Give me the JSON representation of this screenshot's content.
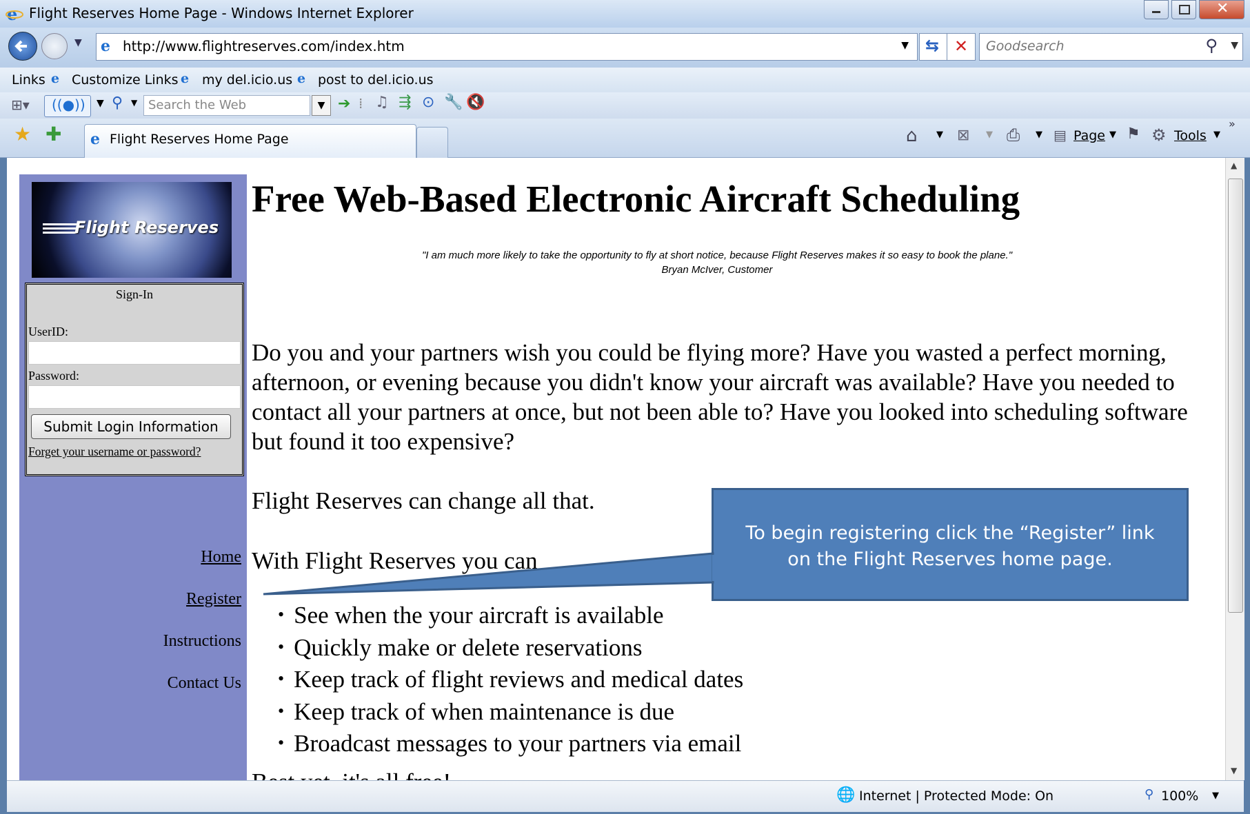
{
  "window": {
    "title": "Flight Reserves Home Page - Windows Internet Explorer"
  },
  "address_bar": {
    "url": "http://www.flightreserves.com/index.htm",
    "search_placeholder": "Goodsearch"
  },
  "links_bar": {
    "label": "Links",
    "items": [
      "Customize Links",
      "my del.icio.us",
      "post to del.icio.us"
    ]
  },
  "toolbar2": {
    "search_placeholder": "Search the Web"
  },
  "tab_bar": {
    "active_tab": "Flight Reserves Home Page",
    "page_menu": "Page",
    "tools_menu": "Tools"
  },
  "page": {
    "logo_text": "Flight Reserves",
    "signin": {
      "title": "Sign-In",
      "userid_label": "UserID:",
      "password_label": "Password:",
      "submit_label": "Submit Login Information",
      "forgot_link": "Forget your username or password?"
    },
    "nav": [
      "Home",
      "Register",
      "Instructions",
      "Contact Us"
    ],
    "headline": "Free Web-Based Electronic Aircraft Scheduling",
    "quote": "\"I am much more likely to take the opportunity to fly at short notice, because Flight Reserves makes it so easy to book the plane.\"",
    "quote_author": "Bryan McIver, Customer",
    "intro": "Do you and your partners wish you could be flying more? Have you wasted a perfect morning, afternoon, or evening because you didn't know your aircraft was available? Have you needed to contact all your partners at once, but not been able to? Have you looked into scheduling software but found it too expensive?",
    "change_line": "Flight Reserves can change all that.",
    "with_line": "With Flight Reserves you can",
    "bullets": [
      "See when the your aircraft is available",
      "Quickly make or delete reservations",
      "Keep track of flight reviews and medical dates",
      "Keep track of when maintenance is due",
      "Broadcast messages to your partners via email"
    ],
    "cutoff_line": "Best yet, it's all free!"
  },
  "callout": {
    "text": "To begin registering click the “Register” link on the Flight Reserves home page."
  },
  "status_bar": {
    "zone": "Internet | Protected Mode: On",
    "zoom": "100%"
  },
  "colors": {
    "sidebar": "#8089c8",
    "callout": "#4f7fb9"
  }
}
